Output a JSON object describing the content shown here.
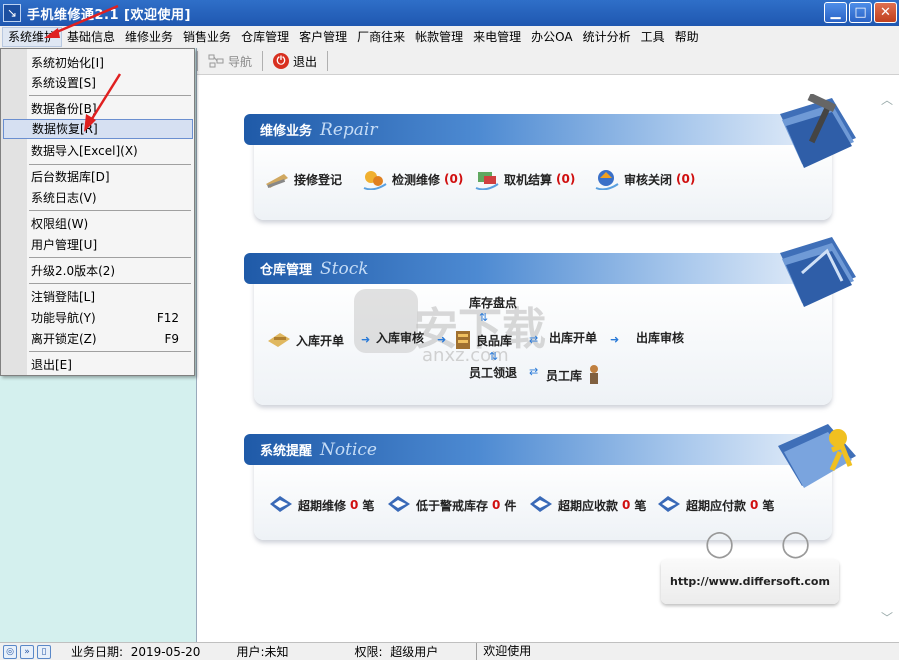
{
  "titlebar": {
    "title": "手机维修通2.1  [欢迎使用]"
  },
  "menubar": {
    "items": [
      "系统维护",
      "基础信息",
      "维修业务",
      "销售业务",
      "仓库管理",
      "客户管理",
      "厂商往来",
      "帐款管理",
      "来电管理",
      "办公OA",
      "统计分析",
      "工具",
      "帮助"
    ]
  },
  "toolbar": {
    "nav_label": "导航",
    "exit_label": "退出"
  },
  "dropdown": {
    "items": [
      {
        "label": "系统初始化[I]"
      },
      {
        "label": "系统设置[S]"
      },
      {
        "label": "数据备份[B]"
      },
      {
        "label": "数据恢复[R]"
      },
      {
        "label": "数据导入[Excel](X)"
      },
      {
        "label": "后台数据库[D]"
      },
      {
        "label": "系统日志(V)"
      },
      {
        "label": "权限组(W)"
      },
      {
        "label": "用户管理[U]"
      },
      {
        "label": "升级2.0版本(2)"
      },
      {
        "label": "注销登陆[L]"
      },
      {
        "label": "功能导航(Y)",
        "shortcut": "F12"
      },
      {
        "label": "离开锁定(Z)",
        "shortcut": "F9"
      },
      {
        "label": "退出[E]"
      }
    ]
  },
  "repair": {
    "title": "维修业务",
    "en": "Repair",
    "actions": [
      {
        "label": "接修登记",
        "count": ""
      },
      {
        "label": "检测维修",
        "count": "(0)"
      },
      {
        "label": "取机结算",
        "count": "(0)"
      },
      {
        "label": "审核关闭",
        "count": "(0)"
      }
    ]
  },
  "stock": {
    "title": "仓库管理",
    "en": "Stock",
    "inbound": "入库开单",
    "in_audit": "入库审核",
    "good_store": "良品库",
    "out_order": "出库开单",
    "out_audit": "出库审核",
    "inventory": "库存盘点",
    "staff_return": "员工领退",
    "staff_store": "员工库"
  },
  "notice": {
    "title": "系统提醒",
    "en": "Notice",
    "items": [
      {
        "pre": "超期维修",
        "n": "0",
        "post": "笔"
      },
      {
        "pre": "低于警戒库存",
        "n": "0",
        "post": "件"
      },
      {
        "pre": "超期应收款",
        "n": "0",
        "post": "笔"
      },
      {
        "pre": "超期应付款",
        "n": "0",
        "post": "笔"
      }
    ]
  },
  "footer": {
    "url": "http://www.differsoft.com"
  },
  "watermark": {
    "cn": "安下载",
    "en": "anxz.com"
  },
  "statusbar": {
    "date_label": "业务日期:",
    "date": "2019-05-20",
    "user_label": "用户:",
    "user": "未知",
    "perm_label": "权限:",
    "perm": "超级用户",
    "msg": "欢迎使用"
  }
}
